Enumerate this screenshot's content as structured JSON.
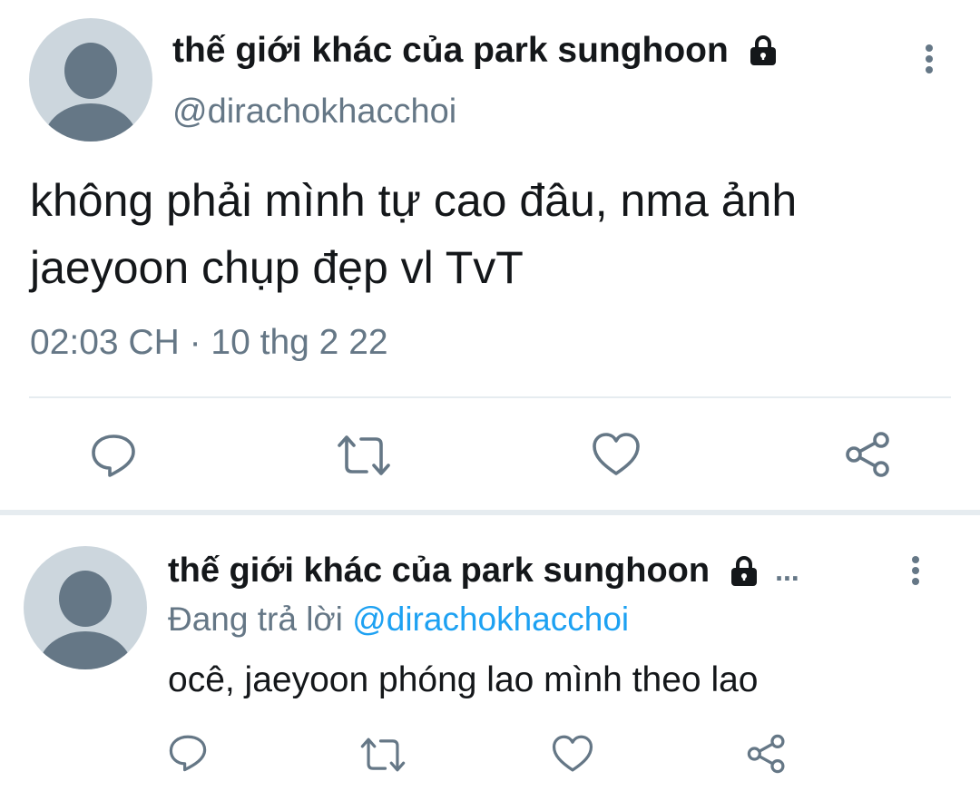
{
  "main_tweet": {
    "display_name": "thế giới khác của park sunghoon",
    "handle": "@dirachokhacchoi",
    "protected_icon": "lock-icon",
    "text": "không phải mình tự cao đâu, nma ảnh jaeyoon chụp đẹp vl TvT",
    "timestamp": "02:03 CH · 10 thg 2 22",
    "actions": [
      "reply-icon",
      "retweet-icon",
      "like-icon",
      "share-icon"
    ]
  },
  "reply_tweet": {
    "display_name": "thế giới khác của park sunghoon",
    "truncation": "...",
    "protected_icon": "lock-icon",
    "replying_prefix": "Đang trả lời",
    "replying_to": "@dirachokhacchoi",
    "text": "ocê, jaeyoon phóng lao mình theo lao",
    "actions": [
      "reply-icon",
      "retweet-icon",
      "like-icon",
      "share-icon"
    ]
  },
  "colors": {
    "text_primary": "#14171a",
    "text_secondary": "#657786",
    "link": "#1da1f2",
    "avatar_bg": "#ccd6dd",
    "avatar_figure": "#657786",
    "divider": "#e6ecf0"
  }
}
